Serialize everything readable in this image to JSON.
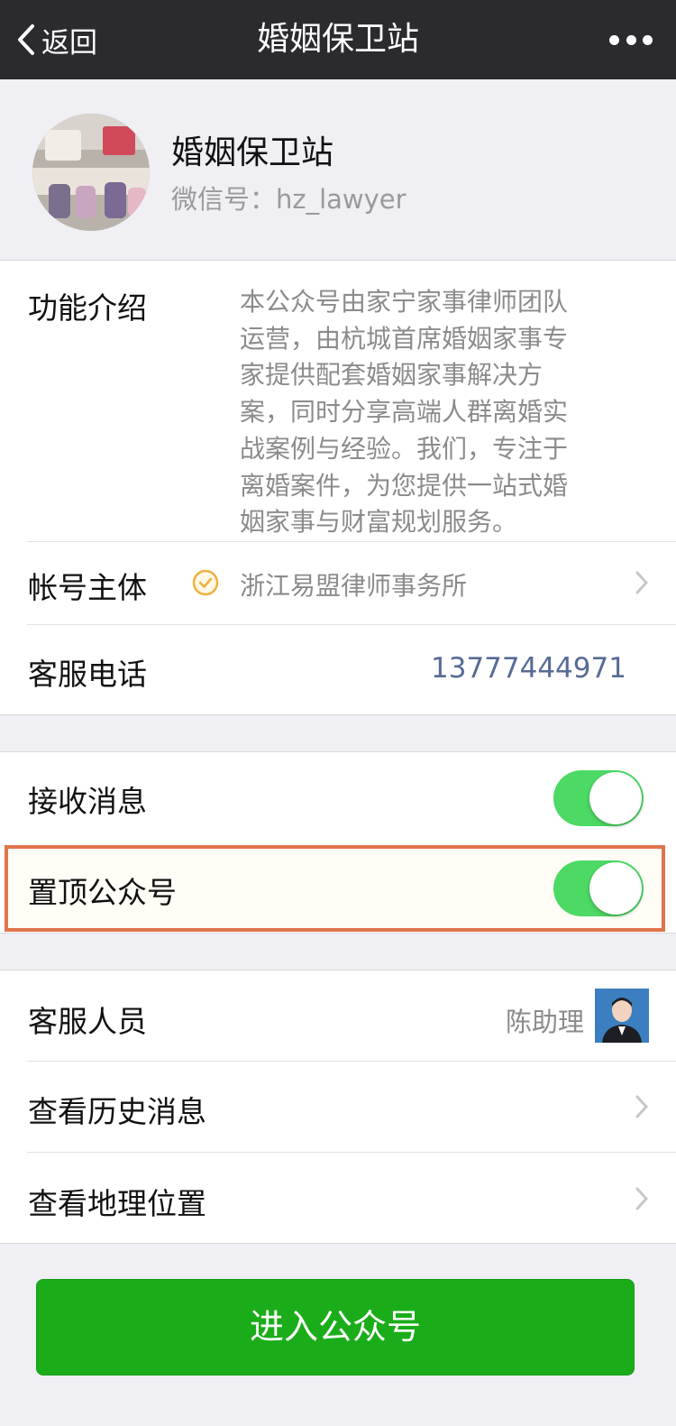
{
  "nav": {
    "back_label": "返回",
    "title": "婚姻保卫站"
  },
  "profile": {
    "name": "婚姻保卫站",
    "wechat_id": "微信号：hz_lawyer"
  },
  "info": {
    "intro_label": "功能介绍",
    "intro_lines": [
      "本公众号由家宁家事律师团队",
      "运营，由杭城首席婚姻家事专",
      "家提供配套婚姻家事解决方",
      "案，同时分享高端人群离婚实",
      "战案例与经验。我们，专注于",
      "离婚案件，为您提供一站式婚",
      "姻家事与财富规划服务。"
    ],
    "account_label": "帐号主体",
    "account_value": "浙江易盟律师事务所",
    "phone_label": "客服电话",
    "phone_value": "13777444971"
  },
  "settings": {
    "receive_label": "接收消息",
    "receive_on": true,
    "pin_label": "置顶公众号",
    "pin_on": true
  },
  "more": {
    "staff_label": "客服人员",
    "staff_name": "陈助理",
    "history_label": "查看历史消息",
    "location_label": "查看地理位置"
  },
  "enter_button": "进入公众号",
  "colors": {
    "accent_green": "#1aad19",
    "toggle_green": "#4cd964",
    "highlight": "#e0734a",
    "link": "#576b95"
  }
}
